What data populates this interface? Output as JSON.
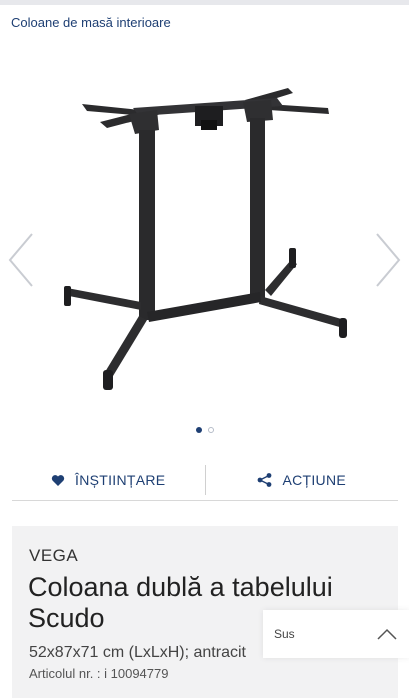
{
  "breadcrumb": {
    "label": "Coloane de masă interioare"
  },
  "gallery": {
    "image_alt": "table-base-double-column",
    "dots_total": 2,
    "active_index": 0
  },
  "actions": {
    "notify_label": "ÎNȘTIINȚARE",
    "share_label": "ACȚIUNE"
  },
  "product": {
    "brand": "VEGA",
    "title": "Coloana dublă a tabelului Scudo",
    "dimensions": "52x87x71 cm (LxLxH); antracit",
    "article": "Articolul nr. : i 10094779"
  },
  "scroll_top": {
    "label": "Sus"
  },
  "colors": {
    "accent": "#1e3f73",
    "card_bg": "#f2f2f3"
  }
}
